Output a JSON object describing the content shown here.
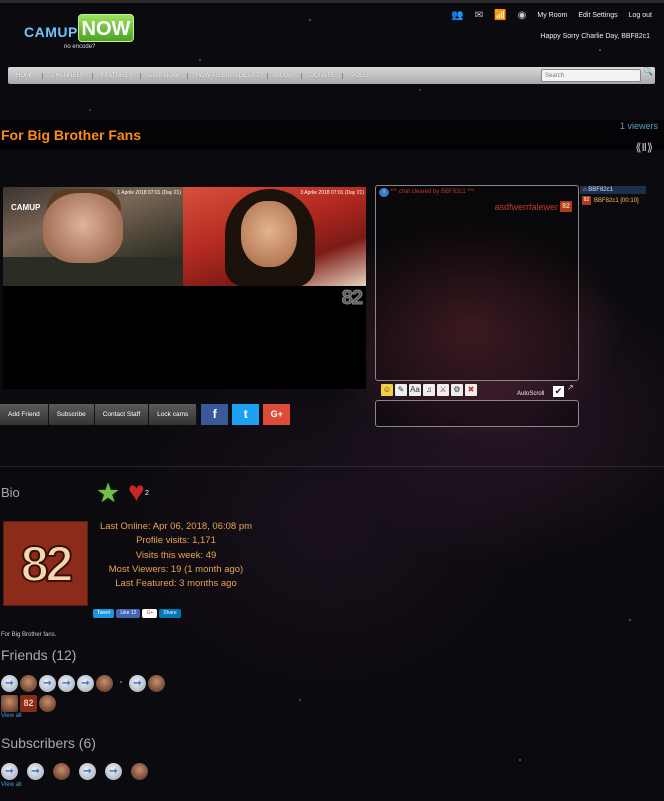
{
  "header": {
    "logo_camup": "CAMUP",
    "logo_now": "NOW",
    "logo_tagline": "no encode?",
    "my_room": "My Room",
    "edit_settings": "Edit Settings",
    "logout": "Log out",
    "greeting": "Happy Sorry Charlie Day, BBF82c1"
  },
  "nav": {
    "items": [
      "HOME",
      "CHANNELS",
      "FEATURES",
      "LIVE NOW",
      "HOW TO BROADCAST",
      "BLOG",
      "DONATE",
      "POLLS"
    ],
    "search_placeholder": "Search"
  },
  "room": {
    "title": "For Big Brother Fans",
    "viewers": "1 viewers",
    "video_badge": "82",
    "cam1_label": "CAMUP",
    "cam1_info": "1 Aprile 2018 07:01 (Day 21)",
    "cam2_info": "3 Aprile 2018 07:01 (Day 21)"
  },
  "actions": {
    "add_friend": "Add Friend",
    "subscribe": "Subscribe",
    "contact_staff": "Contact Staff",
    "lock_cams": "Lock cams",
    "facebook": "f",
    "twitter": "t",
    "googleplus": "G+"
  },
  "chat": {
    "system_message": "*** chat cleared by BBF82c1 ***",
    "message_user": "asdfwerrfalewer",
    "message_badge": "82",
    "autoscroll": "AutoScroll",
    "userlist_header": "BBF82c1",
    "userlist_user": "BBF82c1 [00:10]",
    "userlist_badge": "82"
  },
  "bio": {
    "title": "Bio",
    "heart_count": "2",
    "avatar_text": "82",
    "last_online": "Last Online: Apr 06, 2018, 06:08 pm",
    "profile_visits": "Profile visits: 1,171",
    "visits_week": "Visits this week: 49",
    "most_viewers": "Most Viewers: 19 (1 month ago)",
    "last_featured": "Last Featured: 3 months ago",
    "share_tweet": "Tweet",
    "share_like": "Like 12",
    "share_gplus": "G+",
    "share_linkedin": "Share",
    "description": "For Big Brother fans."
  },
  "friends": {
    "title": "Friends (12)",
    "view_all": "View all",
    "badge": "82"
  },
  "subscribers": {
    "title": "Subscribers (6)",
    "view_all": "View all"
  }
}
